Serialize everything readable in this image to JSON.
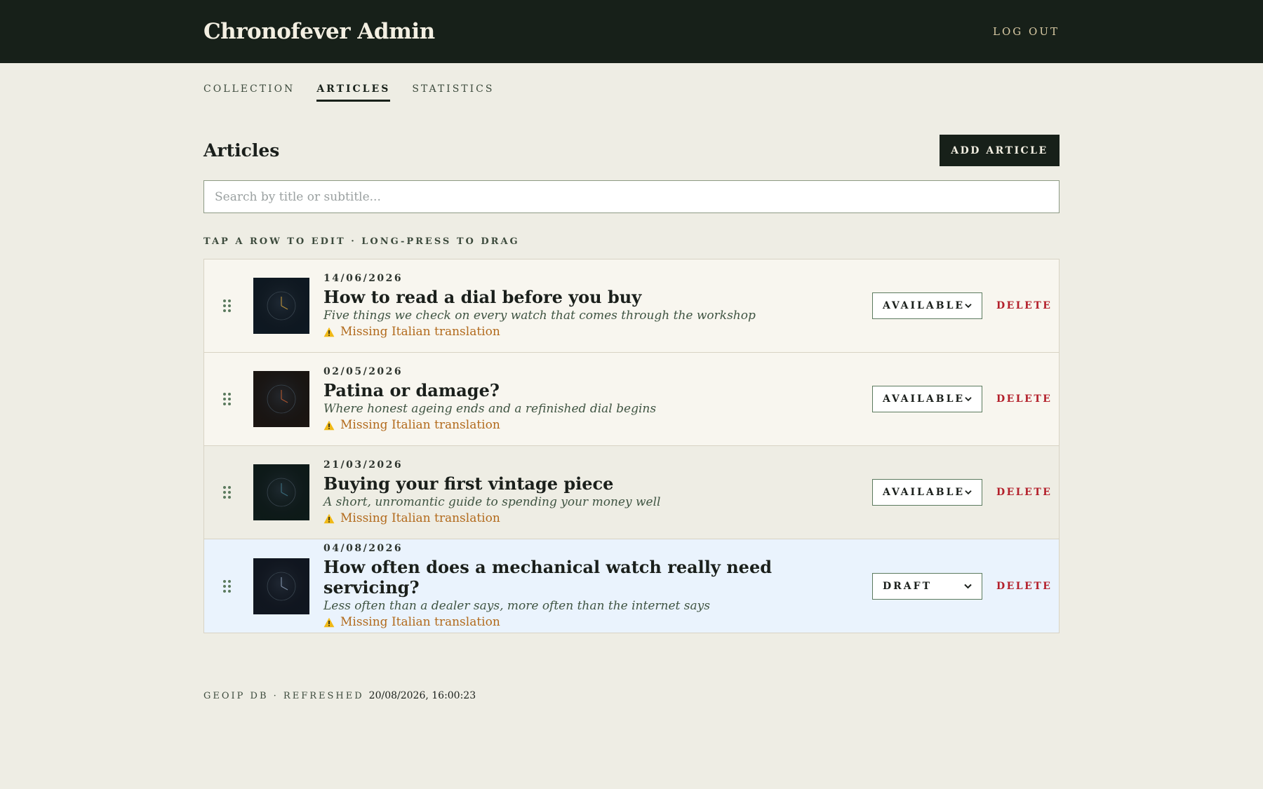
{
  "header": {
    "brand": "Chronofever Admin",
    "logout_label": "LOG OUT"
  },
  "tabs": [
    {
      "label": "COLLECTION",
      "active": false
    },
    {
      "label": "ARTICLES",
      "active": true
    },
    {
      "label": "STATISTICS",
      "active": false
    }
  ],
  "page": {
    "title": "Articles",
    "add_label": "ADD ARTICLE",
    "search_placeholder": "Search by title or subtitle...",
    "hint": "TAP A ROW TO EDIT · LONG-PRESS TO DRAG"
  },
  "articles": [
    {
      "date": "14/06/2026",
      "title": "How to read a dial before you buy",
      "subtitle": "Five things we check on every watch that comes through the workshop",
      "warning": "Missing Italian translation",
      "status": "AVAILABLE",
      "delete_label": "DELETE",
      "thumb_bg": "#0f1a24",
      "thumb_hand": "#b08a3a"
    },
    {
      "date": "02/05/2026",
      "title": "Patina or damage?",
      "subtitle": "Where honest ageing ends and a refinished dial begins",
      "warning": "Missing Italian translation",
      "status": "AVAILABLE",
      "delete_label": "DELETE",
      "thumb_bg": "#1c1612",
      "thumb_hand": "#a8532e"
    },
    {
      "date": "21/03/2026",
      "title": "Buying your first vintage piece",
      "subtitle": "A short, unromantic guide to spending your money well",
      "warning": "Missing Italian translation",
      "status": "AVAILABLE",
      "delete_label": "DELETE",
      "thumb_bg": "#0e1c1a",
      "thumb_hand": "#3a6a7a"
    },
    {
      "date": "04/08/2026",
      "title": "How often does a mechanical watch really need servicing?",
      "subtitle": "Less often than a dealer says, more often than the internet says",
      "warning": "Missing Italian translation",
      "status": "DRAFT",
      "delete_label": "DELETE",
      "thumb_bg": "#111722",
      "thumb_hand": "#7a8aa0"
    }
  ],
  "footer": {
    "label": "GEOIP DB · REFRESHED",
    "value": "20/08/2026, 16:00:23"
  }
}
